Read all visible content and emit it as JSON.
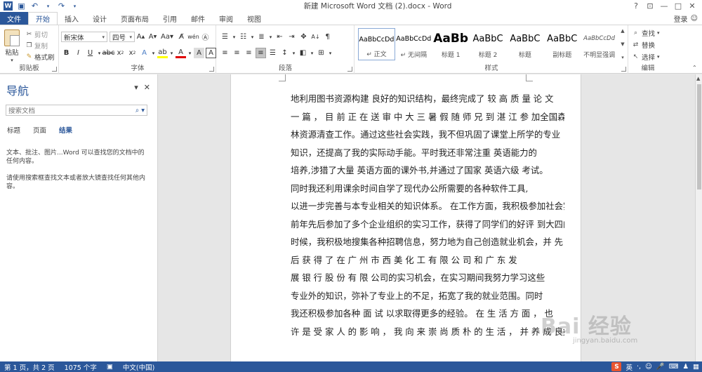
{
  "window": {
    "title": "新建 Microsoft Word 文档 (2).docx - Word",
    "help": "?",
    "minimize": "—",
    "restore": "□",
    "close": "✕"
  },
  "tabs": [
    {
      "label": "文件"
    },
    {
      "label": "开始"
    },
    {
      "label": "插入"
    },
    {
      "label": "设计"
    },
    {
      "label": "页面布局"
    },
    {
      "label": "引用"
    },
    {
      "label": "邮件"
    },
    {
      "label": "审阅"
    },
    {
      "label": "视图"
    }
  ],
  "login": "登录",
  "clipboard": {
    "paste": "粘贴",
    "cut": "剪切",
    "copy": "复制",
    "format_painter": "格式刷",
    "label": "剪贴板"
  },
  "font": {
    "name": "新宋体",
    "size": "四号",
    "label": "字体"
  },
  "paragraph": {
    "label": "段落"
  },
  "styles": {
    "label": "样式",
    "items": [
      {
        "sample": "AaBbCcDd",
        "name": "↵ 正文"
      },
      {
        "sample": "AaBbCcDd",
        "name": "↵ 无间隔"
      },
      {
        "sample": "AaBb",
        "name": "标题 1"
      },
      {
        "sample": "AaBbC",
        "name": "标题 2"
      },
      {
        "sample": "AaBbC",
        "name": "标题"
      },
      {
        "sample": "AaBbC",
        "name": "副标题"
      },
      {
        "sample": "AaBbCcDd",
        "name": "不明显强调"
      }
    ]
  },
  "editing": {
    "find": "查找",
    "replace": "替换",
    "select": "选择",
    "label": "编辑"
  },
  "nav": {
    "title": "导航",
    "search_placeholder": "搜索文档",
    "tabs": [
      "标题",
      "页面",
      "结果"
    ],
    "message1": "文本、批注、图片...Word 可以查找您的文档中的任何内容。",
    "message2": "请使用搜索框查找文本或者放大镜查找任何其他内容。"
  },
  "document": {
    "lines": [
      "地利用图书资源构建 良好的知识结构，最终完成了 较 高 质 量 论 文",
      "一 篇 ， 目 前 正 在 送 审 中 大 三 暑 假 随 师 兄 到 湛 江 参 加全国森",
      "林资源清查工作。通过这些社会实践，我不但巩固了课堂上所学的专业",
      "知识，还提高了我的实际动手能。平时我还非常注重 英语能力的",
      "培养,涉猎了大量 英语方面的课外书,并通过了国家 英语六级  考试。",
      "同时我还利用课余时间自学了现代办公所需要的各种软件工具,",
      "以进一步完善与本专业相关的知识体系。  在工作方面，我积极参加社会实践",
      "前年先后参加了多个企业组织的实习工作，获得了同学们的好评  到大四的",
      "时候，我积极地搜集各种招聘信息，努力地为自己创造就业机会，并 先",
      "后 获 得 了 在 广 州 市 西 美 化 工 有 限 公 司 和 广 东 发",
      "展 银 行 股 份 有 限 公司的实习机会，在实习期间我努力学习这些",
      "专业外的知识，弥补了专业上的不足，拓宽了我的就业范围。同时",
      "我还积极参加各种 面 试 以求取得更多的经验。  在 生 活 方 面 ，  也",
      "许 是 受 家 人 的 影 响 ， 我 向 来 崇 尚 质 朴 的 生 活 ， 并 养 成 良好"
    ]
  },
  "watermark": {
    "logo": "Bai 经验",
    "url": "jingyan.baidu.com"
  },
  "status": {
    "page": "第 1 页，共 2 页",
    "words": "1075 个字",
    "language": "中文(中国)",
    "ime": "S",
    "ime_lang": "英"
  }
}
